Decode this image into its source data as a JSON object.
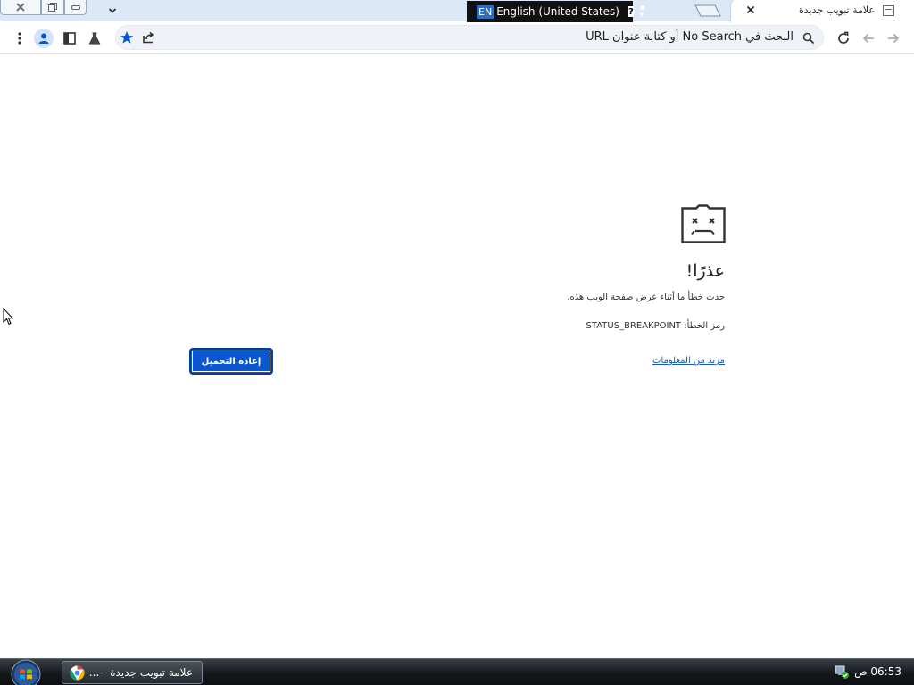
{
  "browser": {
    "tab": {
      "title": "علامة تبويب جديدة",
      "favicon": "new-tab-page-icon"
    },
    "omnibox": {
      "text": "البحث في No Search أو كتابة عنوان URL"
    },
    "toolbar_icons": [
      "menu-icon",
      "profile-icon",
      "side-panel-icon",
      "labs-icon",
      "bookmark-star-icon",
      "share-icon",
      "reload-icon",
      "back-icon",
      "forward-icon"
    ]
  },
  "language_bar": {
    "code": "EN",
    "label": "English (United States)"
  },
  "error_page": {
    "title": "عذرًا!",
    "message": "حدث خطأ ما أثناء عرض صفحة الويب هذه.",
    "code_label": "رمز الخطأ:",
    "code_value": "STATUS_BREAKPOINT",
    "learn_more": "مزيد من المعلومات",
    "reload_label": "إعادة التحميل"
  },
  "taskbar": {
    "item_label": "علامة تبويب جديدة - ...",
    "clock": "06:53 ص"
  },
  "colors": {
    "accent": "#0b57d0",
    "link": "#1a57b3",
    "tabstrip": "#dde8f6"
  }
}
